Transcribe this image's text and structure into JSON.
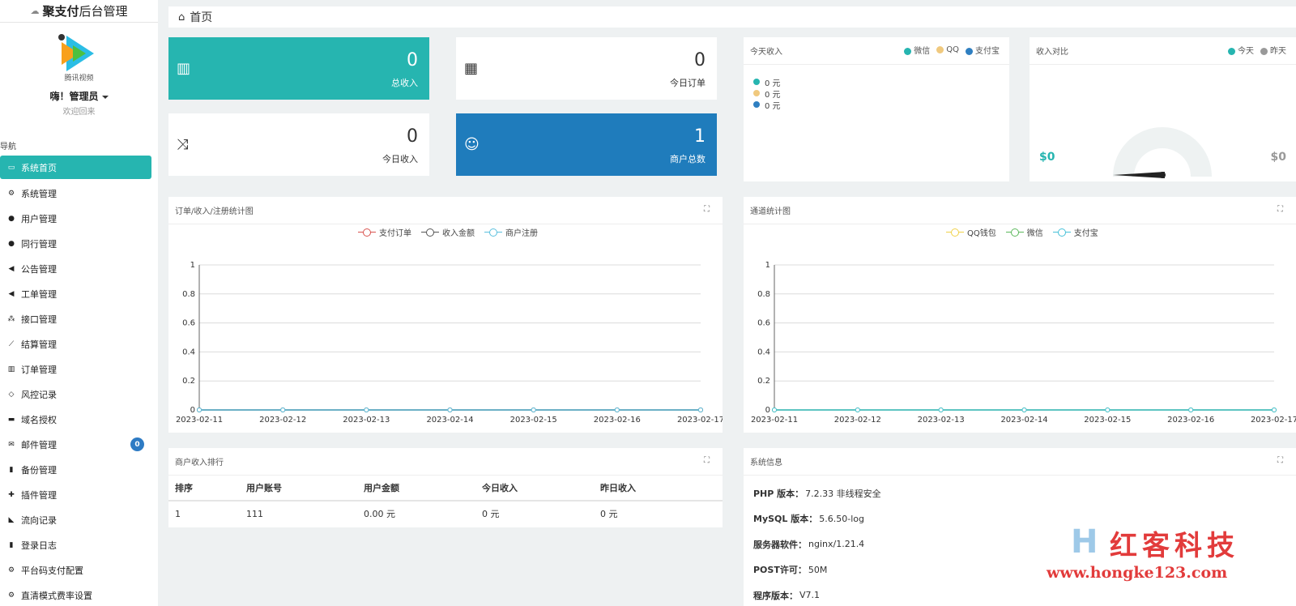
{
  "sidebar": {
    "brand_bold": "聚支付",
    "brand_rest": "后台管理",
    "logo_caption": "腾讯视频",
    "admin_name": "嗨！管理员",
    "welcome": "欢迎回来",
    "nav_title": "导航",
    "items": [
      {
        "label": "系统首页",
        "icon": "monitor-icon",
        "glyph": "▭",
        "active": true
      },
      {
        "label": "系统管理",
        "icon": "gears-icon",
        "glyph": "⚙"
      },
      {
        "label": "用户管理",
        "icon": "user-icon",
        "glyph": "●"
      },
      {
        "label": "同行管理",
        "icon": "user-icon",
        "glyph": "●"
      },
      {
        "label": "公告管理",
        "icon": "volume-icon",
        "glyph": "◀"
      },
      {
        "label": "工单管理",
        "icon": "volume-icon",
        "glyph": "◀"
      },
      {
        "label": "接口管理",
        "icon": "sitemap-icon",
        "glyph": "⁂"
      },
      {
        "label": "结算管理",
        "icon": "line-chart-icon",
        "glyph": "⟋"
      },
      {
        "label": "订单管理",
        "icon": "bar-chart-icon",
        "glyph": "▥"
      },
      {
        "label": "风控记录",
        "icon": "code-icon",
        "glyph": "◇"
      },
      {
        "label": "域名授权",
        "icon": "credit-card-icon",
        "glyph": "▬"
      },
      {
        "label": "邮件管理",
        "icon": "envelope-icon",
        "glyph": "✉",
        "badge": "0"
      },
      {
        "label": "备份管理",
        "icon": "file-icon",
        "glyph": "▮"
      },
      {
        "label": "插件管理",
        "icon": "puzzle-icon",
        "glyph": "✚"
      },
      {
        "label": "流向记录",
        "icon": "area-chart-icon",
        "glyph": "◣"
      },
      {
        "label": "登录日志",
        "icon": "file-icon",
        "glyph": "▮"
      },
      {
        "label": "平台码支付配置",
        "icon": "gears-icon",
        "glyph": "⚙"
      },
      {
        "label": "直清模式费率设置",
        "icon": "gears-icon",
        "glyph": "⚙"
      }
    ]
  },
  "header": {
    "title": "首页"
  },
  "tiles": {
    "total_income": {
      "value": "0",
      "label": "总收入"
    },
    "today_orders": {
      "value": "0",
      "label": "今日订单"
    },
    "today_income": {
      "value": "0",
      "label": "今日收入"
    },
    "merchants": {
      "value": "1",
      "label": "商户总数"
    }
  },
  "today_panel": {
    "title": "今天收入",
    "legend": [
      "微信",
      "QQ",
      "支付宝"
    ],
    "colors": [
      "#26b5b0",
      "#f0c97e",
      "#2f7fc1"
    ],
    "rows": [
      "0 元",
      "0 元",
      "0 元"
    ]
  },
  "compare_panel": {
    "title": "收入对比",
    "legend": [
      "今天",
      "昨天"
    ],
    "colors": [
      "#26b5b0",
      "#999999"
    ],
    "today_amount": "$0",
    "yesterday_amount": "$0",
    "gauge_value": 0
  },
  "chart_data": [
    {
      "type": "line",
      "title": "订单/收入/注册统计图",
      "x": [
        "2023-02-11",
        "2023-02-12",
        "2023-02-13",
        "2023-02-14",
        "2023-02-15",
        "2023-02-16",
        "2023-02-17"
      ],
      "ylim": [
        0,
        1
      ],
      "yticks": [
        "0",
        "0.2",
        "0.4",
        "0.6",
        "0.8",
        "1"
      ],
      "legend_position": "top-center",
      "grid": true,
      "series": [
        {
          "name": "支付订单",
          "color": "#d9534f",
          "values": [
            0,
            0,
            0,
            0,
            0,
            0,
            0
          ]
        },
        {
          "name": "收入金额",
          "color": "#555555",
          "values": [
            0,
            0,
            0,
            0,
            0,
            0,
            0
          ]
        },
        {
          "name": "商户注册",
          "color": "#5bc0de",
          "values": [
            0,
            0,
            0,
            0,
            0,
            0,
            0
          ]
        }
      ]
    },
    {
      "type": "line",
      "title": "通道统计图",
      "x": [
        "2023-02-11",
        "2023-02-12",
        "2023-02-13",
        "2023-02-14",
        "2023-02-15",
        "2023-02-16",
        "2023-02-17"
      ],
      "ylim": [
        0,
        1
      ],
      "yticks": [
        "0",
        "0.2",
        "0.4",
        "0.6",
        "0.8",
        "1"
      ],
      "legend_position": "top-center",
      "grid": true,
      "series": [
        {
          "name": "QQ钱包",
          "color": "#f0d24a",
          "values": [
            0,
            0,
            0,
            0,
            0,
            0,
            0
          ]
        },
        {
          "name": "微信",
          "color": "#5cb85c",
          "values": [
            0,
            0,
            0,
            0,
            0,
            0,
            0
          ]
        },
        {
          "name": "支付宝",
          "color": "#46c1d8",
          "values": [
            0,
            0,
            0,
            0,
            0,
            0,
            0
          ]
        }
      ]
    }
  ],
  "rank_panel": {
    "title": "商户收入排行",
    "headers": [
      "排序",
      "用户账号",
      "用户金额",
      "今日收入",
      "昨日收入"
    ],
    "rows": [
      [
        "1",
        "111",
        "0.00 元",
        "0 元",
        "0 元"
      ]
    ]
  },
  "sysinfo_panel": {
    "title": "系统信息",
    "rows": [
      {
        "k": "PHP 版本：",
        "v": "7.2.33 非线程安全"
      },
      {
        "k": "MySQL 版本：",
        "v": "5.6.50-log"
      },
      {
        "k": "服务器软件：",
        "v": "nginx/1.21.4"
      },
      {
        "k": "POST许可：",
        "v": "50M"
      },
      {
        "k": "程序版本：",
        "v": "V7.1"
      }
    ]
  },
  "watermark": {
    "logo": "H",
    "title": "红客科技",
    "url": "www.hongke123.com"
  }
}
